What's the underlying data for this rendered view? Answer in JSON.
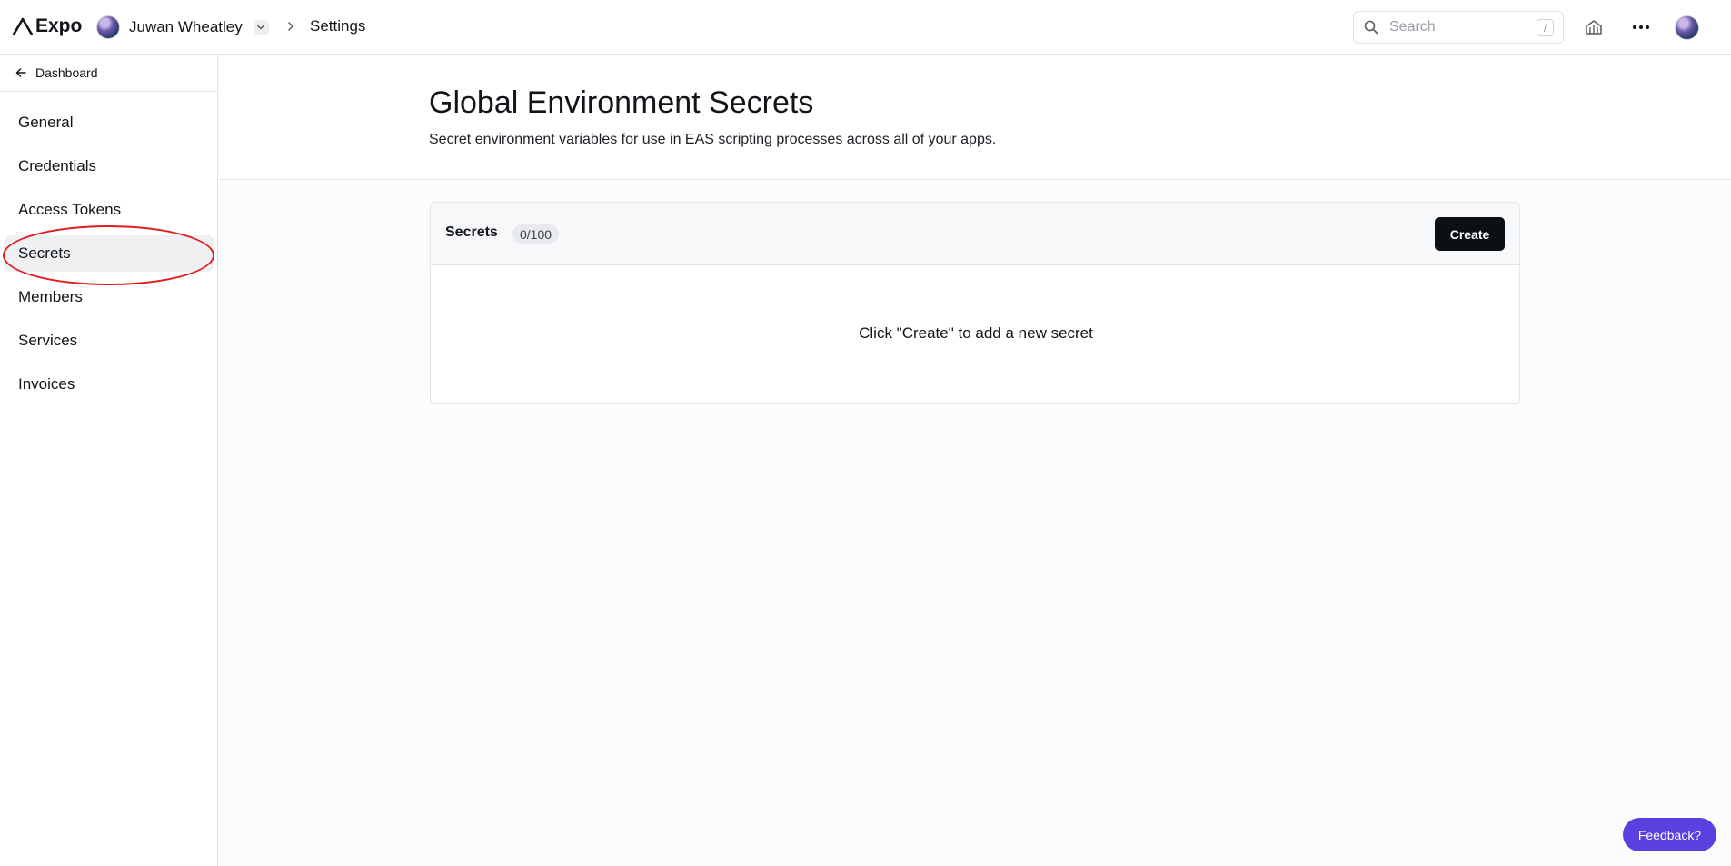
{
  "app": {
    "brand": "Expo"
  },
  "header": {
    "account_name": "Juwan Wheatley",
    "breadcrumb_current": "Settings",
    "search_placeholder": "Search",
    "search_shortcut": "/"
  },
  "sidebar": {
    "back_label": "Dashboard",
    "items": [
      {
        "label": "General"
      },
      {
        "label": "Credentials"
      },
      {
        "label": "Access Tokens"
      },
      {
        "label": "Secrets",
        "active": true
      },
      {
        "label": "Members"
      },
      {
        "label": "Services"
      },
      {
        "label": "Invoices"
      }
    ]
  },
  "page": {
    "title": "Global Environment Secrets",
    "subtitle": "Secret environment variables for use in EAS scripting processes across all of your apps."
  },
  "secrets_card": {
    "title": "Secrets",
    "count": "0/100",
    "create_label": "Create",
    "empty_message": "Click \"Create\" to add a new secret"
  },
  "feedback_label": "Feedback?",
  "colors": {
    "accent": "#5b3fe0",
    "primary_button": "#0b1015",
    "annotation": "#e01e1e"
  }
}
